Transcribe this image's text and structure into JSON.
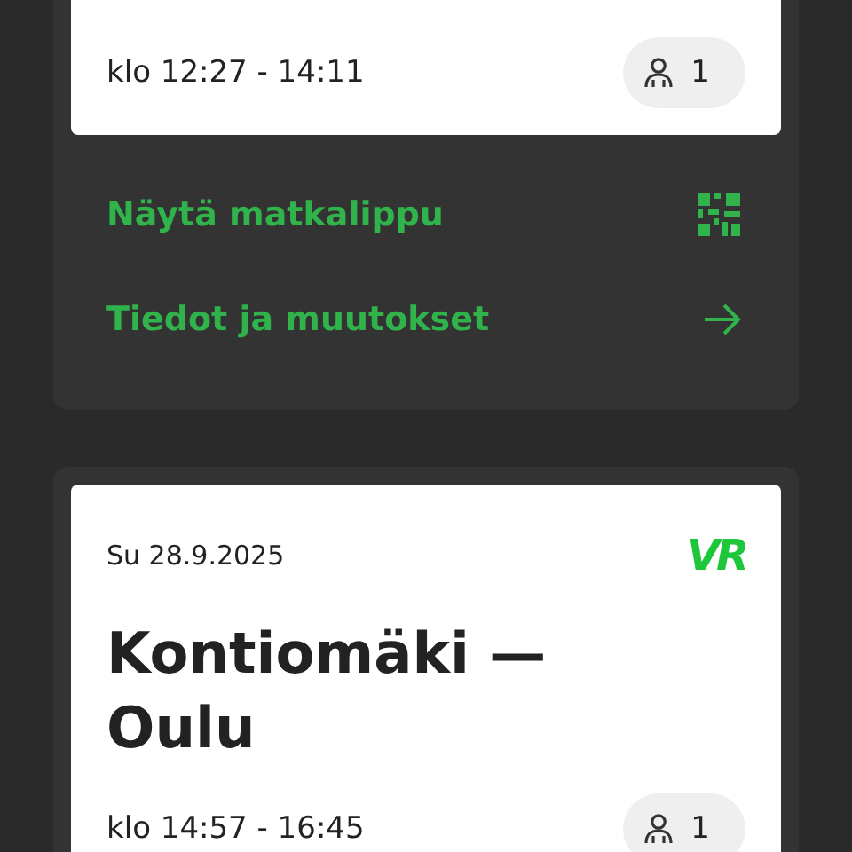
{
  "trips": [
    {
      "time": "klo 12:27 - 14:11",
      "passengers": "1",
      "actions": [
        {
          "kind": "ticket",
          "label": "Näytä matkalippu"
        },
        {
          "kind": "details",
          "label": "Tiedot ja muutokset"
        }
      ]
    },
    {
      "date": "Su 28.9.2025",
      "logo": "VR",
      "title": "Kontiomäki —\nOulu",
      "time": "klo 14:57 - 16:45",
      "passengers": "1"
    }
  ]
}
